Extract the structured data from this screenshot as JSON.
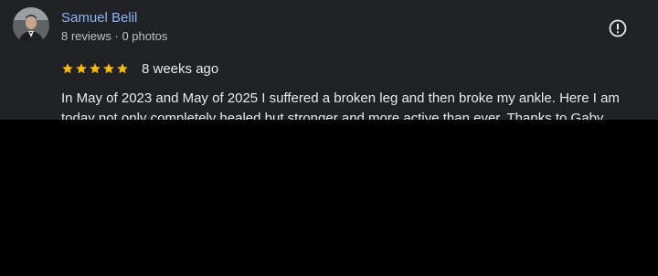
{
  "review": {
    "author_name": "Samuel Belil",
    "author_meta": "8 reviews · 0 photos",
    "rating": 5,
    "rating_max": 5,
    "date": "8 weeks ago",
    "text": "In May of 2023 and May of 2025 I suffered a broken leg and then broke my ankle. Here I am today not only completely healed but stronger and more active than ever. Thanks to Gaby"
  },
  "icons": {
    "report": "report-flag-icon",
    "star": "star-icon"
  },
  "colors": {
    "card_background": "#202124",
    "author_link": "#8ab4f8",
    "star_fill": "#fbbc04",
    "primary_text": "#e8eaed",
    "secondary_text": "#bdc1c6",
    "page_background": "#000000"
  }
}
